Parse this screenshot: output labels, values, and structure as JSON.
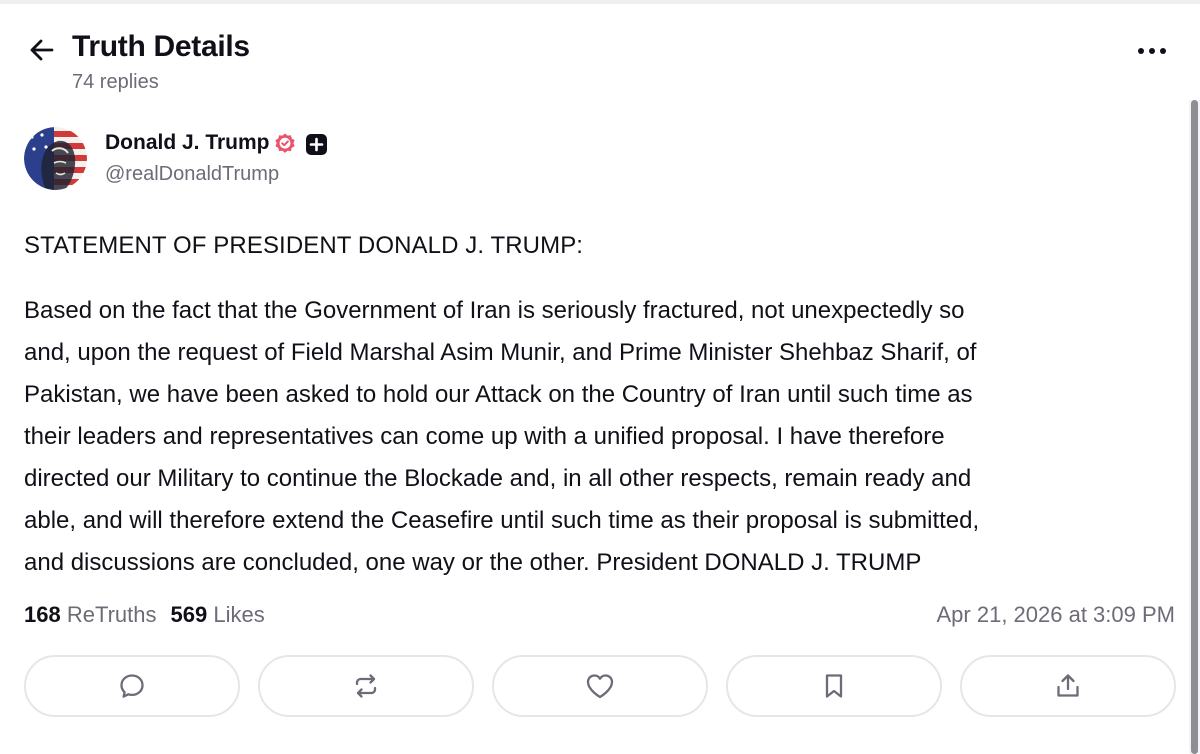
{
  "header": {
    "title": "Truth Details",
    "replies": "74 replies",
    "back_icon": "arrow-left-icon",
    "more_icon": "ellipsis-icon"
  },
  "author": {
    "name": "Donald J. Trump",
    "handle": "@realDonaldTrump",
    "verified_icon": "verified-badge-icon",
    "plus_icon": "plus-badge-icon",
    "verified_color": "#e9556b"
  },
  "post": {
    "heading": "STATEMENT OF PRESIDENT DONALD J. TRUMP:",
    "lines": [
      "Based on the fact that the Government of Iran is seriously fractured, not unexpectedly so",
      "and, upon the request of Field Marshal Asim Munir, and Prime Minister Shehbaz Sharif, of",
      "Pakistan, we have been asked to hold our Attack on the Country of Iran until such time as",
      "their leaders and representatives can come up with a unified proposal. I have therefore",
      "directed our Military to continue the Blockade and, in all other respects, remain ready and",
      "able, and will therefore extend the Ceasefire until such time as their proposal is submitted,",
      "and discussions are concluded, one way or the other. President DONALD J. TRUMP"
    ]
  },
  "stats": {
    "retruths_count": "168",
    "retruths_label": "ReTruths",
    "likes_count": "569",
    "likes_label": "Likes",
    "date": "Apr 21, 2026 at 3:09 PM"
  },
  "actions": [
    {
      "name": "reply",
      "icon": "comment-icon"
    },
    {
      "name": "retruth",
      "icon": "repost-icon"
    },
    {
      "name": "like",
      "icon": "heart-icon"
    },
    {
      "name": "bookmark",
      "icon": "bookmark-icon"
    },
    {
      "name": "share",
      "icon": "share-icon"
    }
  ],
  "colors": {
    "text": "#101018",
    "muted": "#6c6c78",
    "border": "#e6e6ea",
    "icon": "#6c6c78"
  }
}
